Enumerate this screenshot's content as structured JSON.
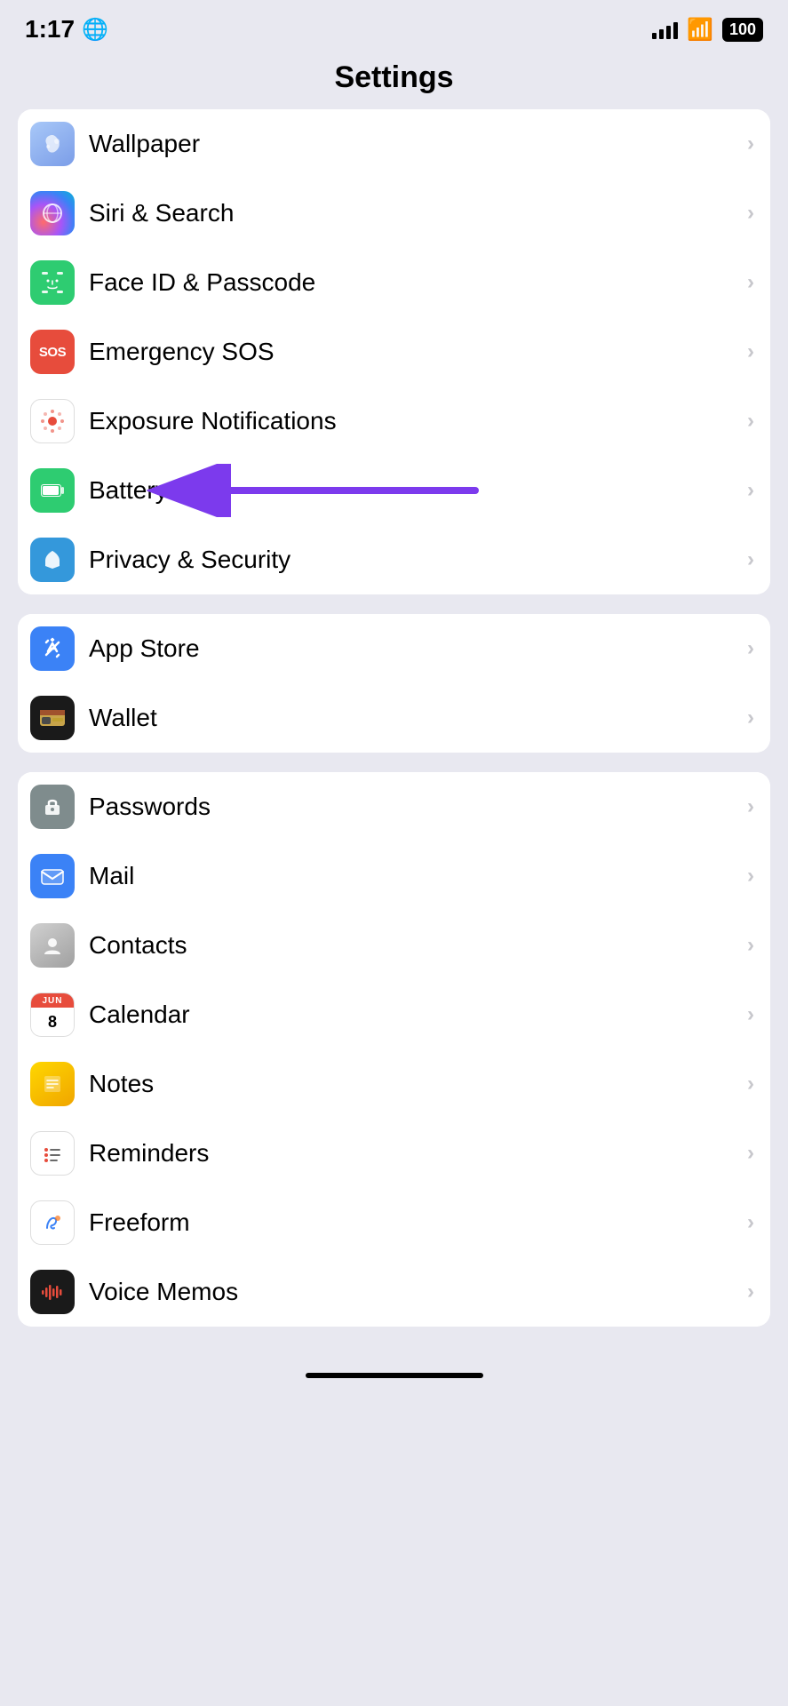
{
  "statusBar": {
    "time": "1:17",
    "battery": "100",
    "signal_full": true
  },
  "navTitle": "Settings",
  "groups": [
    {
      "id": "group1",
      "items": [
        {
          "id": "wallpaper",
          "label": "Wallpaper",
          "iconType": "wallpaper",
          "iconEmoji": "❋"
        },
        {
          "id": "siri",
          "label": "Siri & Search",
          "iconType": "siri",
          "iconEmoji": ""
        },
        {
          "id": "faceid",
          "label": "Face ID & Passcode",
          "iconType": "faceid",
          "iconEmoji": "🪪"
        },
        {
          "id": "sos",
          "label": "Emergency SOS",
          "iconType": "sos",
          "iconEmoji": "SOS"
        },
        {
          "id": "exposure",
          "label": "Exposure Notifications",
          "iconType": "exposure",
          "iconEmoji": "🔴"
        },
        {
          "id": "battery",
          "label": "Battery",
          "iconType": "battery",
          "iconEmoji": "🔋",
          "hasArrow": true
        },
        {
          "id": "privacy",
          "label": "Privacy & Security",
          "iconType": "privacy",
          "iconEmoji": "✋"
        }
      ]
    },
    {
      "id": "group2",
      "items": [
        {
          "id": "appstore",
          "label": "App Store",
          "iconType": "appstore",
          "iconEmoji": "✦"
        },
        {
          "id": "wallet",
          "label": "Wallet",
          "iconType": "wallet",
          "iconEmoji": "💳"
        }
      ]
    },
    {
      "id": "group3",
      "items": [
        {
          "id": "passwords",
          "label": "Passwords",
          "iconType": "passwords",
          "iconEmoji": "🔑"
        },
        {
          "id": "mail",
          "label": "Mail",
          "iconType": "mail",
          "iconEmoji": "✉"
        },
        {
          "id": "contacts",
          "label": "Contacts",
          "iconType": "contacts",
          "iconEmoji": "👤"
        },
        {
          "id": "calendar",
          "label": "Calendar",
          "iconType": "calendar",
          "iconEmoji": "📅"
        },
        {
          "id": "notes",
          "label": "Notes",
          "iconType": "notes",
          "iconEmoji": "📝"
        },
        {
          "id": "reminders",
          "label": "Reminders",
          "iconType": "reminders",
          "iconEmoji": "📋"
        },
        {
          "id": "freeform",
          "label": "Freeform",
          "iconType": "freeform",
          "iconEmoji": "✏️"
        },
        {
          "id": "voicememos",
          "label": "Voice Memos",
          "iconType": "voicememos",
          "iconEmoji": "🎙"
        }
      ]
    }
  ],
  "chevron": "›",
  "arrowText": "←"
}
